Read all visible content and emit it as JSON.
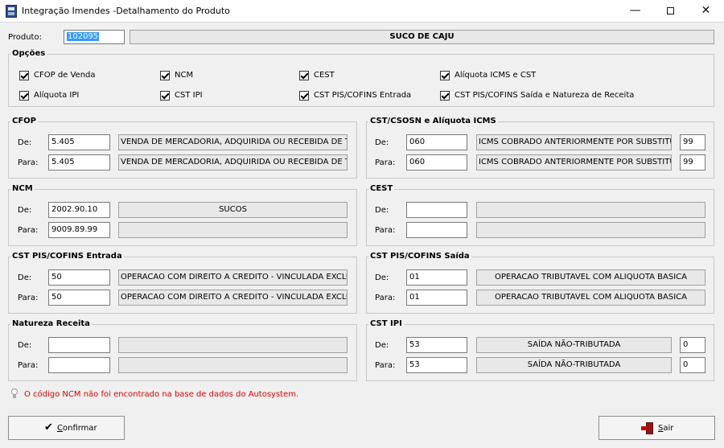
{
  "window": {
    "title": "Integração Imendes -Detalhamento do Produto",
    "minimize": "—",
    "close": "✕"
  },
  "produto": {
    "label": "Produto:",
    "code": "102095",
    "name": "SUCO DE CAJU"
  },
  "opcoes": {
    "title": "Opções",
    "items": [
      {
        "label": "CFOP de Venda",
        "checked": true
      },
      {
        "label": "NCM",
        "checked": true
      },
      {
        "label": "CEST",
        "checked": true
      },
      {
        "label": "Alíquota ICMS e CST",
        "checked": true
      },
      {
        "label": "Alíquota IPI",
        "checked": true
      },
      {
        "label": "CST IPI",
        "checked": true
      },
      {
        "label": "CST PIS/COFINS Entrada",
        "checked": true
      },
      {
        "label": "CST PIS/COFINS Saída e Natureza de Receita",
        "checked": true
      }
    ]
  },
  "labels": {
    "de": "De:",
    "para": "Para:"
  },
  "cfop": {
    "title": "CFOP",
    "de": {
      "code": "5.405",
      "desc": "VENDA DE MERCADORIA, ADQUIRIDA OU RECEBIDA DE TER"
    },
    "para": {
      "code": "5.405",
      "desc": "VENDA DE MERCADORIA, ADQUIRIDA OU RECEBIDA DE TER"
    }
  },
  "cst_icms": {
    "title": "CST/CSOSN e Alíquota ICMS",
    "de": {
      "code": "060",
      "desc": "ICMS COBRADO ANTERIORMENTE POR SUBSTITUIÇ",
      "aliquota": "99"
    },
    "para": {
      "code": "060",
      "desc": "ICMS COBRADO ANTERIORMENTE POR SUBSTITUIÇ",
      "aliquota": "99"
    }
  },
  "ncm": {
    "title": "NCM",
    "de": {
      "code": "2002.90.10",
      "desc": "SUCOS"
    },
    "para": {
      "code": "9009.89.99",
      "desc": ""
    }
  },
  "cest": {
    "title": "CEST",
    "de": {
      "code": "",
      "desc": ""
    },
    "para": {
      "code": "",
      "desc": ""
    }
  },
  "pis_entrada": {
    "title": "CST PIS/COFINS Entrada",
    "de": {
      "code": "50",
      "desc": "OPERACAO COM DIREITO A CREDITO - VINCULADA EXCLUS"
    },
    "para": {
      "code": "50",
      "desc": "OPERACAO COM DIREITO A CREDITO - VINCULADA EXCLUS"
    }
  },
  "pis_saida": {
    "title": "CST PIS/COFINS Saída",
    "de": {
      "code": "01",
      "desc": "OPERACAO TRIBUTAVEL COM ALIQUOTA BASICA"
    },
    "para": {
      "code": "01",
      "desc": "OPERACAO TRIBUTAVEL COM ALIQUOTA BASICA"
    }
  },
  "natureza": {
    "title": "Natureza Receita",
    "de": {
      "code": "",
      "desc": ""
    },
    "para": {
      "code": "",
      "desc": ""
    }
  },
  "cst_ipi": {
    "title": "CST IPI",
    "de": {
      "code": "53",
      "desc": "SAÍDA NÃO-TRIBUTADA",
      "aliquota": "0"
    },
    "para": {
      "code": "53",
      "desc": "SAÍDA NÃO-TRIBUTADA",
      "aliquota": "0"
    }
  },
  "warning": {
    "text": "O código NCM não foi encontrado na base de dados do Autosystem.",
    "color": "#e00000"
  },
  "buttons": {
    "confirm": {
      "underline": "C",
      "rest": "onfirmar"
    },
    "exit": {
      "underline": "S",
      "rest": "air"
    }
  }
}
